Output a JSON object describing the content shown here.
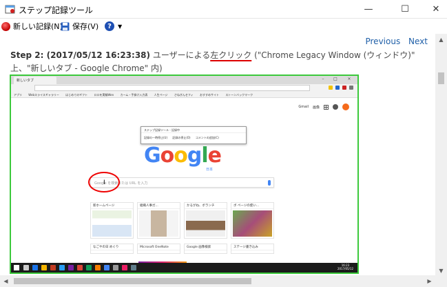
{
  "window": {
    "title": "ステップ記録ツール",
    "minimize_glyph": "—",
    "maximize_glyph": "☐",
    "close_glyph": "✕"
  },
  "toolbar": {
    "new_record_label": "新しい記録(N)",
    "save_label": "保存(V)",
    "help_glyph": "?",
    "help_caret": "▼"
  },
  "nav": {
    "previous_label": "Previous",
    "next_label": "Next"
  },
  "step": {
    "header": "Step 2: (2017/05/12 16:23:38)",
    "text_before": " ユーザーによる",
    "action": "左クリック",
    "text_after": " (\"Chrome Legacy Window (ウィンドウ)\"",
    "line2": "上、\"新しいタブ - Google Chrome\" 内)"
  },
  "screenshot": {
    "tab_label": "新しいタブ",
    "bookmarks": [
      "アプリ",
      "Webスライスギャラリー",
      "はじめてのギフト",
      "ロロを実験Wen",
      "カーム・手掛け入力表",
      "人生ページ",
      "さねぎんセフィ",
      "おすすめサイト",
      "ストーンバックマーク"
    ],
    "top_right_gmail": "Gmail",
    "top_right_images": "画像",
    "mini_recorder_title": "ステップ記録ツール - 記録中",
    "mini_recorder_pause": "記録の一時停止(U)",
    "mini_recorder_stop": "記録の停止(O)",
    "mini_recorder_comment": "コメントの追加(C)",
    "google_letters": [
      "G",
      "o",
      "o",
      "g",
      "l",
      "e"
    ],
    "google_sub": "日本",
    "search_placeholder": "Google を検索または URL を入力",
    "tiles": [
      {
        "label": "新ホームページ"
      },
      {
        "label": "組織人事ガ..."
      },
      {
        "label": "かるがね、ボランチ"
      },
      {
        "label": "ボ ページの使い..."
      },
      {
        "label": "なごやの日 めぐり"
      },
      {
        "label": "Microsoft OneNote"
      },
      {
        "label": "Google 画像検索"
      },
      {
        "label": "ステージ書き込み"
      }
    ],
    "clock_time": "16:23",
    "clock_date": "2017/05/12"
  },
  "scroll": {
    "up": "▲",
    "down": "▼",
    "left": "◀",
    "right": "▶"
  },
  "colors": {
    "accent_link": "#1f5fa8",
    "frame_green": "#3bc93b",
    "click_red": "#e00000"
  }
}
